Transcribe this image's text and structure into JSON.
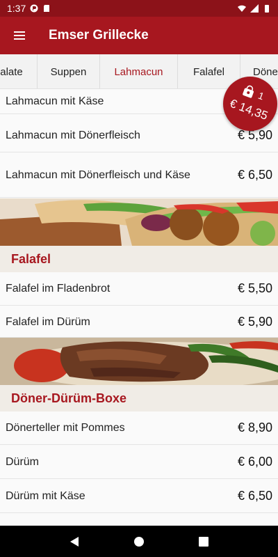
{
  "status_bar": {
    "time": "1:37"
  },
  "app_bar": {
    "title": "Emser Grillecke"
  },
  "tabs": [
    {
      "label": "alate"
    },
    {
      "label": "Suppen"
    },
    {
      "label": "Lahmacun"
    },
    {
      "label": "Falafel"
    },
    {
      "label": "Döne"
    }
  ],
  "active_tab": "Lahmacun",
  "menu": {
    "lahmacun_items": [
      {
        "name": "Lahmacun mit Käse",
        "price": ""
      },
      {
        "name": "Lahmacun mit Dönerfleisch",
        "price": "€ 5,90"
      },
      {
        "name": "Lahmacun mit Dönerfleisch und Käse",
        "price": "€ 6,50"
      }
    ],
    "falafel": {
      "title": "Falafel",
      "items": [
        {
          "name": "Falafel im Fladenbrot",
          "price": "€ 5,50"
        },
        {
          "name": "Falafel im Dürüm",
          "price": "€ 5,90"
        }
      ]
    },
    "doener": {
      "title": "Döner-Dürüm-Boxe",
      "items": [
        {
          "name": "Dönerteller mit Pommes",
          "price": "€ 8,90"
        },
        {
          "name": "Dürüm",
          "price": "€ 6,00"
        },
        {
          "name": "Dürüm mit Käse",
          "price": "€ 6,50"
        }
      ]
    }
  },
  "cart": {
    "count": "1",
    "total": "€ 14,35"
  },
  "colors": {
    "brand": "#a7171f",
    "brand_dark": "#8c1219"
  }
}
